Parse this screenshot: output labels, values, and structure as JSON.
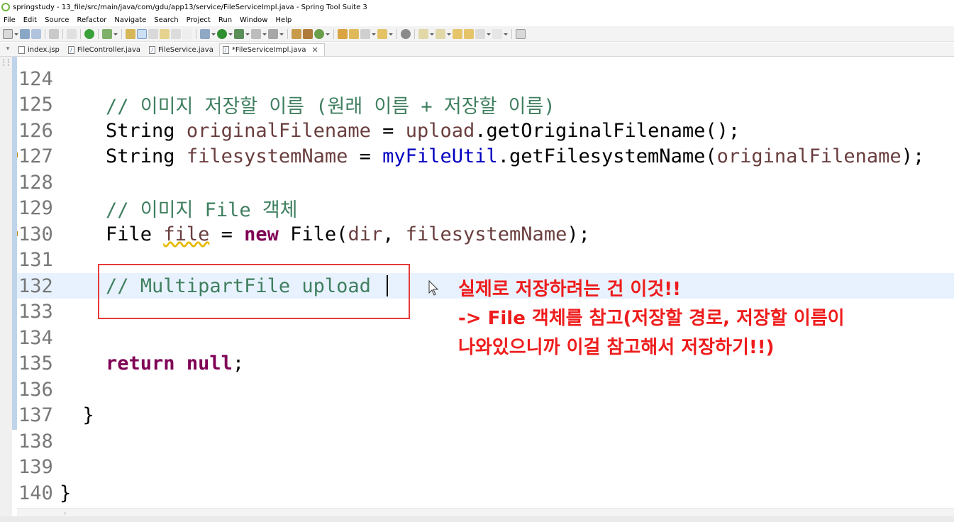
{
  "window": {
    "title": "springstudy - 13_file/src/main/java/com/gdu/app13/service/FileServiceImpl.java - Spring Tool Suite 3"
  },
  "menu": [
    "File",
    "Edit",
    "Source",
    "Refactor",
    "Navigate",
    "Search",
    "Project",
    "Run",
    "Window",
    "Help"
  ],
  "tabs": [
    {
      "label": "index.jsp",
      "active": false
    },
    {
      "label": "FileController.java",
      "active": false
    },
    {
      "label": "FileService.java",
      "active": false
    },
    {
      "label": "*FileServiceImpl.java",
      "active": true
    }
  ],
  "editor": {
    "lines": [
      {
        "num": "124",
        "text": ""
      },
      {
        "num": "125",
        "text": "    // 이미지 저장할 이름 (원래 이름 + 저장할 이름)"
      },
      {
        "num": "126",
        "text": "    String originalFilename = upload.getOriginalFilename();"
      },
      {
        "num": "127",
        "text": "    String filesystemName = myFileUtil.getFilesystemName(originalFilename);"
      },
      {
        "num": "128",
        "text": ""
      },
      {
        "num": "129",
        "text": "    // 이미지 File 객체"
      },
      {
        "num": "130",
        "text": "    File file = new File(dir, filesystemName);"
      },
      {
        "num": "131",
        "text": ""
      },
      {
        "num": "132",
        "text": "    // MultipartFile upload "
      },
      {
        "num": "133",
        "text": ""
      },
      {
        "num": "134",
        "text": ""
      },
      {
        "num": "135",
        "text": "    return null;"
      },
      {
        "num": "136",
        "text": ""
      },
      {
        "num": "137",
        "text": "  }"
      },
      {
        "num": "138",
        "text": ""
      },
      {
        "num": "139",
        "text": ""
      },
      {
        "num": "140",
        "text": "}"
      }
    ]
  },
  "annotation": {
    "line1": "실제로 저장하려는 건 이것!!",
    "line2": "-> File 객체를 참고(저장할 경로, 저장할 이름이",
    "line3": "나와있으니까 이걸 참고해서 저장하기!!)"
  }
}
